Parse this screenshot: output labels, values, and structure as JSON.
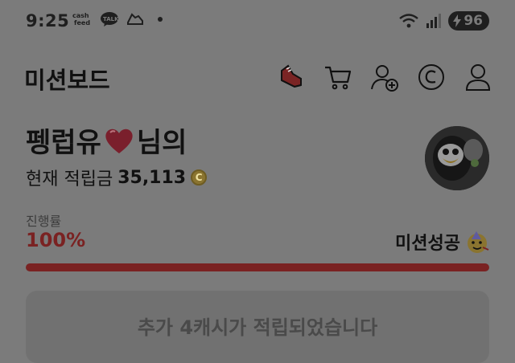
{
  "status": {
    "time": "9:25",
    "app_badge": "cash\nfeed",
    "talk_badge": "TALK",
    "battery": "96"
  },
  "header": {
    "title": "미션보드"
  },
  "profile": {
    "name_prefix": "펭럽유",
    "name_suffix": "님의",
    "savings_label": "현재 적립금",
    "savings_amount": "35,113",
    "coin_symbol": "C"
  },
  "progress": {
    "label": "진행률",
    "value_text": "100%",
    "percent": 100,
    "success_text": "미션성공"
  },
  "notice": {
    "text": "추가 4캐시가 적립되었습니다"
  },
  "colors": {
    "accent": "#7a2222",
    "overlay_bg": "#7b7b7b"
  },
  "icons": [
    "shoe-icon",
    "cart-icon",
    "add-user-icon",
    "copyright-icon",
    "user-icon"
  ]
}
